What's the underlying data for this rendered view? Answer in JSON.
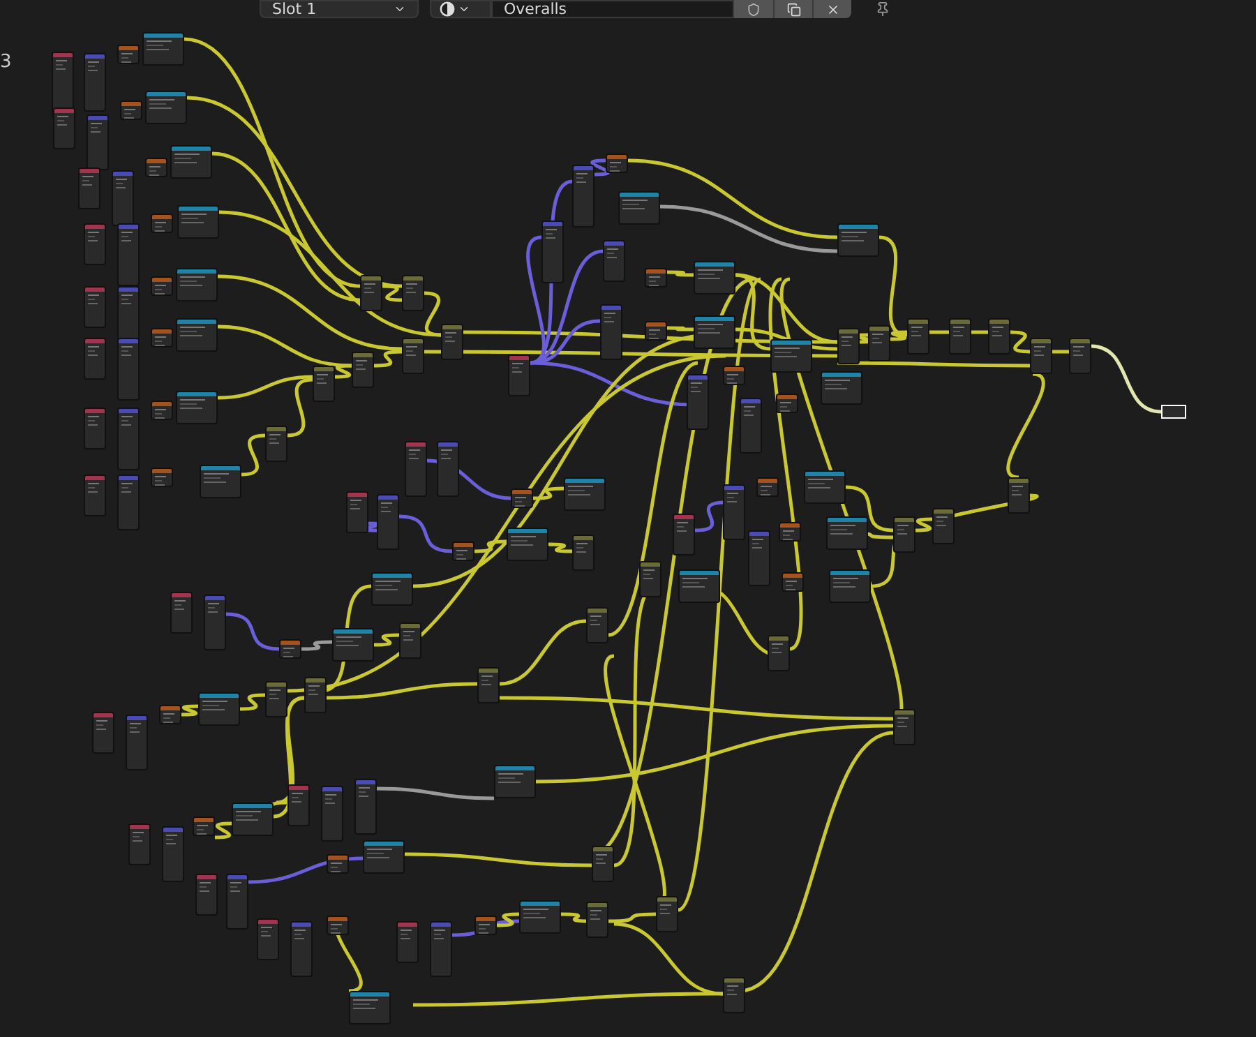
{
  "header": {
    "slot_menu": "Slot 1",
    "material_field": "Overalls"
  },
  "canvas": {
    "edge_label": "3"
  }
}
